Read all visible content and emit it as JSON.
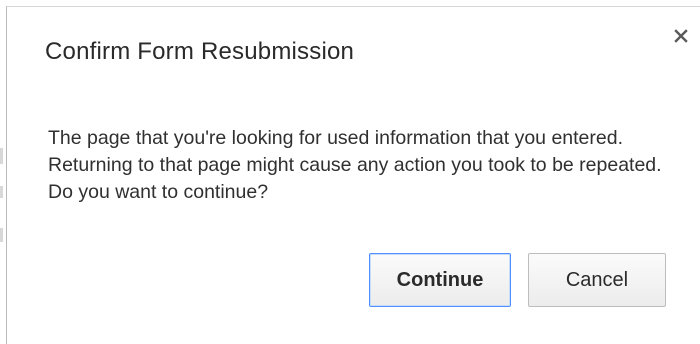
{
  "dialog": {
    "title": "Confirm Form Resubmission",
    "close_icon": "close-icon",
    "message": "The page that you're looking for used information that you entered. Returning to that page might cause any action you took to be repeated. Do you want to continue?",
    "buttons": {
      "continue_label": "Continue",
      "cancel_label": "Cancel"
    }
  },
  "colors": {
    "primary_border": "#4d90fe",
    "button_border": "#bdbdbd",
    "text": "#2a2a2a"
  }
}
